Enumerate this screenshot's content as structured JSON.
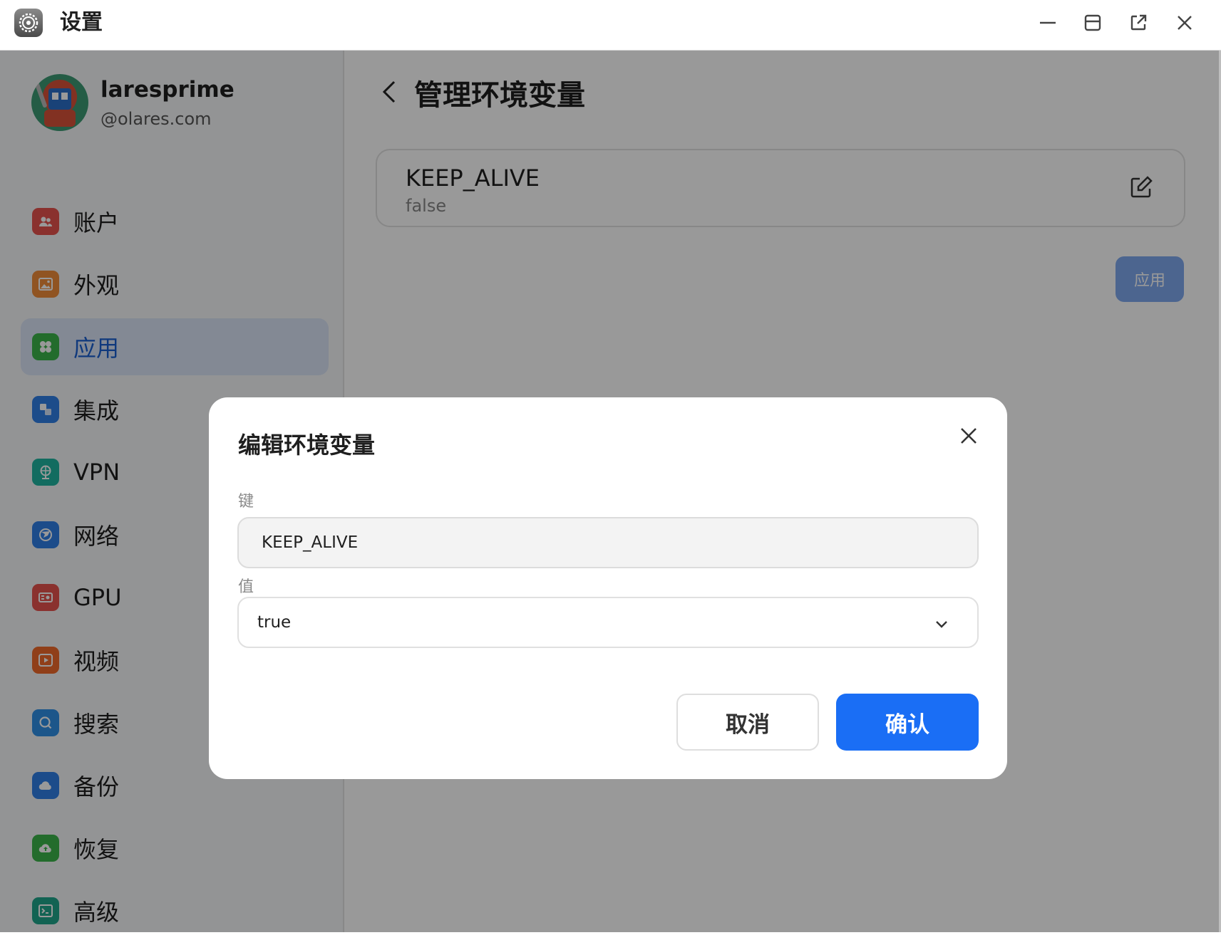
{
  "window": {
    "title": "设置",
    "icon": "gear-icon",
    "controls": [
      "minimize-icon",
      "maximize-icon",
      "external-link-icon",
      "close-icon"
    ]
  },
  "profile": {
    "name": "laresprime",
    "domain": "@olares.com"
  },
  "sidebar": {
    "items": [
      {
        "label": "账户",
        "icon": "users-icon",
        "color": "#e6534d"
      },
      {
        "label": "外观",
        "icon": "image-icon",
        "color": "#f08c3a"
      },
      {
        "label": "应用",
        "icon": "apps-icon",
        "color": "#3bb54a",
        "active": true
      },
      {
        "label": "集成",
        "icon": "integration-icon",
        "color": "#2f7fe6"
      },
      {
        "label": "VPN",
        "icon": "vpn-globe-icon",
        "color": "#1fb5a0"
      },
      {
        "label": "网络",
        "icon": "network-icon",
        "color": "#2f7fe6"
      },
      {
        "label": "GPU",
        "icon": "gpu-icon",
        "color": "#e6534d"
      },
      {
        "label": "视频",
        "icon": "video-play-icon",
        "color": "#f06a2a"
      },
      {
        "label": "搜索",
        "icon": "search-icon",
        "color": "#2f8fe6"
      },
      {
        "label": "备份",
        "icon": "cloud-icon",
        "color": "#2f7fe6"
      },
      {
        "label": "恢复",
        "icon": "cloud-restore-icon",
        "color": "#3bb54a"
      },
      {
        "label": "高级",
        "icon": "terminal-icon",
        "color": "#1fa68a"
      }
    ]
  },
  "main": {
    "title": "管理环境变量",
    "env_vars": [
      {
        "key": "KEEP_ALIVE",
        "value": "false"
      }
    ],
    "apply_label": "应用"
  },
  "dialog": {
    "title": "编辑环境变量",
    "key_label": "键",
    "key_value": "KEEP_ALIVE",
    "value_label": "值",
    "value_selected": "true",
    "cancel_label": "取消",
    "confirm_label": "确认"
  },
  "colors": {
    "accent": "#1a6ef5",
    "active_nav_text": "#1a5fd0",
    "overlay": "rgba(0,0,0,0.4)"
  }
}
